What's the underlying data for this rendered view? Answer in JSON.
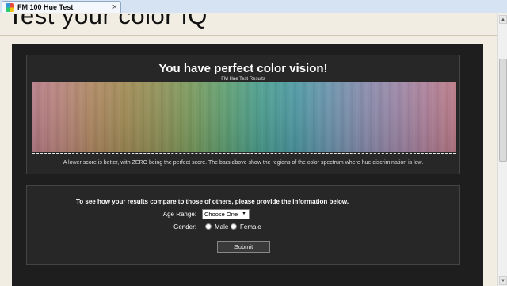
{
  "browser": {
    "tab_title": "FM 100 Hue Test",
    "tab_close": "×",
    "tab_icon": "color-wheel-icon"
  },
  "page": {
    "heading": "Test your color IQ"
  },
  "results": {
    "title": "You have perfect color vision!",
    "chart_subtitle": "FM Hue Test Results",
    "note": "A lower score is better, with ZERO being the perfect score. The bars above show the regions of the color spectrum where hue discrimination is low."
  },
  "form": {
    "intro": "To see how your results compare to those of others, please provide the information below.",
    "age_label": "Age Range:",
    "age_value": "Choose One",
    "gender_label": "Gender:",
    "male_label": "Male",
    "female_label": "Female",
    "submit_label": "Submit"
  },
  "scrollbar": {
    "up_icon": "▲",
    "down_icon": "▼"
  },
  "colors": {
    "panel": "#1e1e1e",
    "box": "#272727",
    "page_bg": "#f1ede2"
  }
}
